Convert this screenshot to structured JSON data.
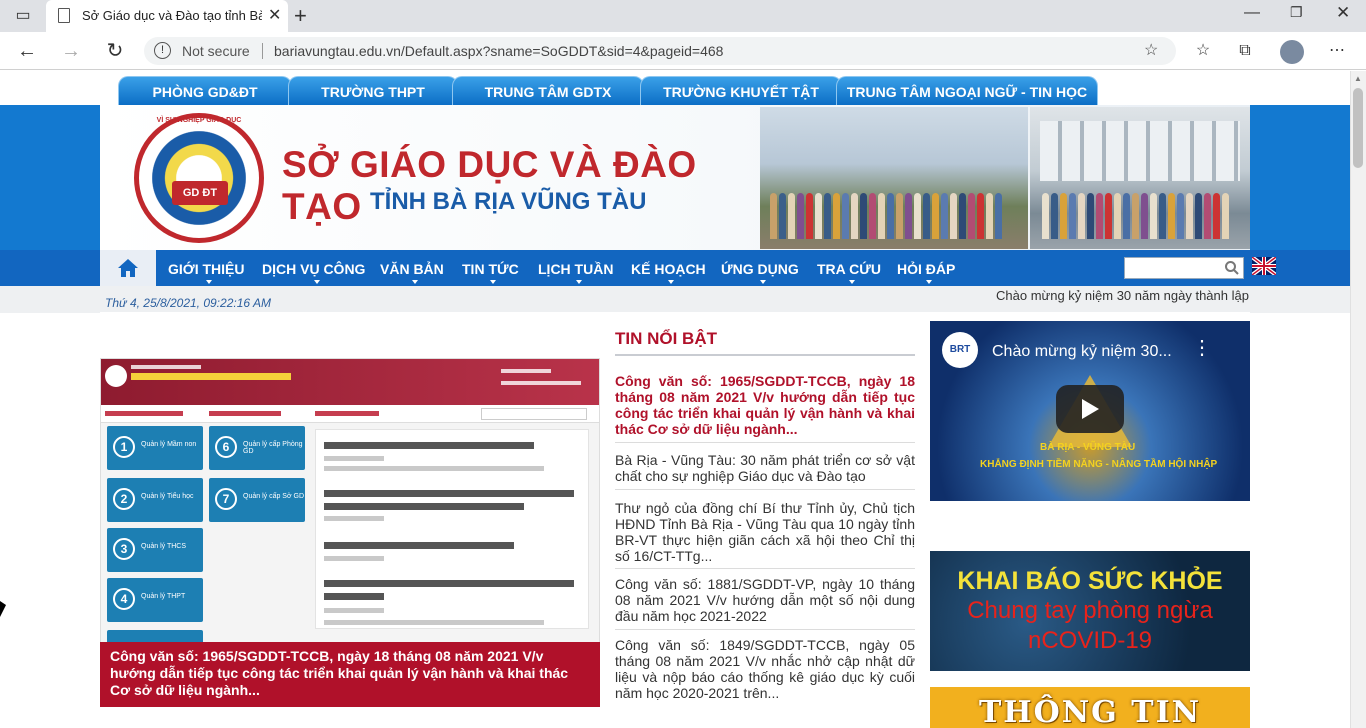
{
  "browser": {
    "tab_title": "Sở Giáo dục và Đào tạo tỉnh Bà R",
    "security_label": "Not secure",
    "url": "bariavungtau.edu.vn/Default.aspx?sname=SoGDDT&sid=4&pageid=468"
  },
  "top_tabs": [
    "PHÒNG GD&ĐT",
    "TRƯỜNG THPT",
    "TRUNG TÂM GDTX",
    "TRƯỜNG KHUYẾT TẬT",
    "TRUNG TÂM NGOẠI NGỮ - TIN HỌC"
  ],
  "banner": {
    "title": "SỞ GIÁO DỤC VÀ ĐÀO TẠO",
    "subtitle": "TỈNH BÀ RỊA VŨNG TÀU",
    "logo_text": "GD ĐT",
    "logo_ring": "VÌ SỰ NGHIỆP GIÁO DỤC"
  },
  "nav": [
    "GIỚI THIỆU",
    "DỊCH VỤ CÔNG",
    "VĂN BẢN",
    "TIN TỨC",
    "LỊCH TUẦN",
    "KẾ HOẠCH",
    "ỨNG DỤNG",
    "TRA CỨU",
    "HỎI ĐÁP"
  ],
  "datebar": {
    "date": "Thứ 4, 25/8/2021, 09:22:16 AM",
    "marquee": "Chào mừng kỷ niệm 30 năm ngày thành lập"
  },
  "feature": {
    "caption": "Công văn số: 1965/SGDDT-TCCB, ngày 18 tháng 08 năm 2021 V/v hướng dẫn tiếp tục công tác triển khai quản lý vận hành và khai thác Cơ sở dữ liệu ngành..."
  },
  "news": {
    "heading": "TIN NỔI BẬT",
    "items": [
      "Công văn số: 1965/SGDDT-TCCB, ngày 18 tháng 08 năm 2021 V/v hướng dẫn tiếp tục công tác triển khai quản lý vận hành và khai thác Cơ sở dữ liệu ngành...",
      "Bà Rịa - Vũng Tàu: 30 năm phát triển cơ sở vật chất cho sự nghiệp Giáo dục và Đào tạo",
      "Thư ngỏ của đồng chí Bí thư Tỉnh ủy, Chủ tịch HĐND Tỉnh Bà Rịa - Vũng Tàu qua 10 ngày tỉnh BR-VT thực hiện giãn cách xã hội theo Chỉ thị số 16/CT-TTg...",
      "Công văn số: 1881/SGDDT-VP, ngày 10 tháng 08 năm 2021 V/v hướng dẫn một số nội dung đầu năm học 2021-2022",
      "Công văn số: 1849/SGDDT-TCCB, ngày 05 tháng 08 năm 2021 V/v nhắc nhở cập nhật dữ liệu và nộp báo cáo thống kê giáo dục kỳ cuối năm học 2020-2021 trên..."
    ]
  },
  "video": {
    "title": "Chào mừng kỷ niệm 30...",
    "channel": "BRT",
    "line1": "BÀ RỊA - VŨNG TÀU",
    "line2": "KHẲNG ĐỊNH TIỀM NĂNG - NÂNG TẦM HỘI NHẬP"
  },
  "covid": {
    "line1": "KHAI BÁO SỨC KHỎE",
    "line2": "Chung tay phòng ngừa",
    "line3": "nCOVID-19"
  },
  "info_banner": "THÔNG TIN",
  "colors": {
    "nav_blue": "#1266c0",
    "accent_red": "#b0112a",
    "banner_blue": "#1379d0"
  }
}
